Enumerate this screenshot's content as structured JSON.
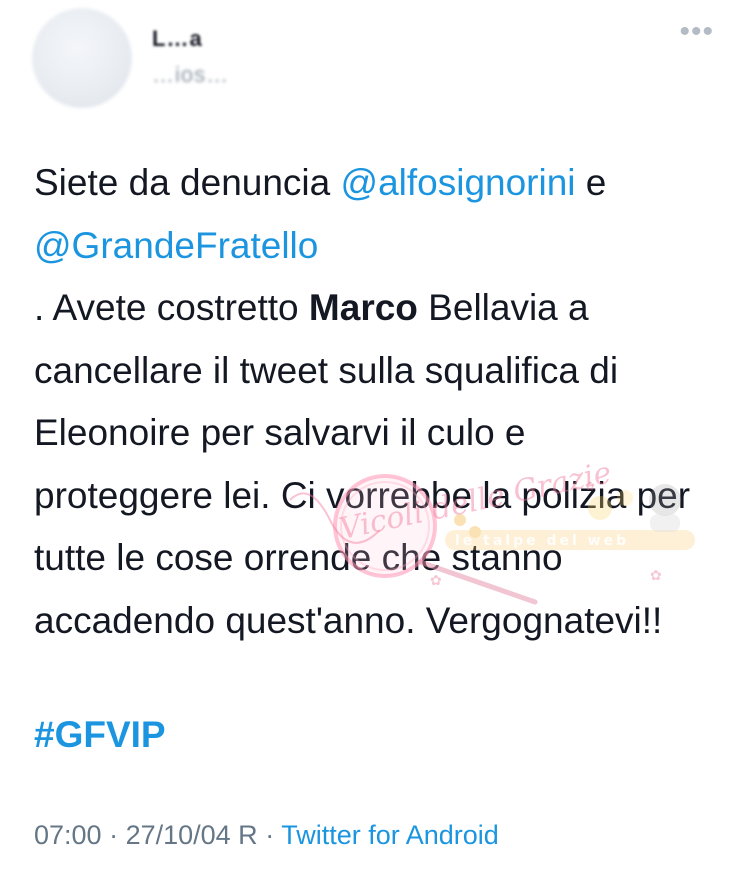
{
  "header": {
    "display_name": "L…a",
    "handle": "…ios…",
    "more_icon": "more-dots-icon"
  },
  "tweet": {
    "line1_pre": "Siete da denuncia ",
    "mention1": "@alfosignorini",
    "line1_post": " e",
    "mention2": "@GrandeFratello",
    "p2_pre": ". Avete costretto ",
    "p2_bold": "Marco",
    "p2_post": " Bellavia a cancellare il tweet sulla squalifica di Eleonoire per salvarvi il culo e proteggere lei. Ci vorrebbe la polizia per tutte le cose orrende che stanno accadendo quest'anno. Vergognatevi!!",
    "hashtag": "#GFVIP"
  },
  "meta": {
    "time": "07:00",
    "sep1": " · ",
    "date": "27/10/04 R",
    "sep2": " · ",
    "source": "Twitter for Android"
  },
  "colors": {
    "link": "#1b95e0",
    "text": "#141823",
    "muted": "#657786"
  },
  "watermark": {
    "script_text": "Vicoli delle Grazie",
    "banner_text": "le talpe del web"
  }
}
